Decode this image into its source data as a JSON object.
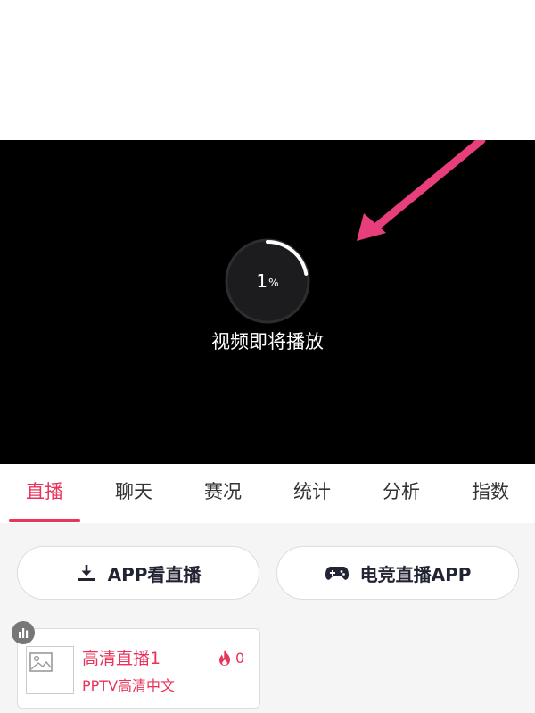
{
  "player": {
    "loading_number": "1",
    "loading_unit": "%",
    "loading_progress": 0.22,
    "loading_caption": "视频即将播放"
  },
  "tabs": [
    {
      "label": "直播",
      "active": true
    },
    {
      "label": "聊天",
      "active": false
    },
    {
      "label": "赛况",
      "active": false
    },
    {
      "label": "统计",
      "active": false
    },
    {
      "label": "分析",
      "active": false
    },
    {
      "label": "指数",
      "active": false
    }
  ],
  "buttons": {
    "app_live_label": "APP看直播",
    "esports_app_label": "电竞直播APP"
  },
  "stream_card": {
    "title": "高清直播1",
    "subtitle": "PPTV高清中文",
    "heat": "0"
  },
  "colors": {
    "accent": "#e8335a",
    "annotation_arrow": "#e83e7c"
  },
  "icons": [
    "download-icon",
    "gamepad-icon",
    "image-placeholder-icon",
    "flame-icon",
    "bar-chart-icon"
  ]
}
